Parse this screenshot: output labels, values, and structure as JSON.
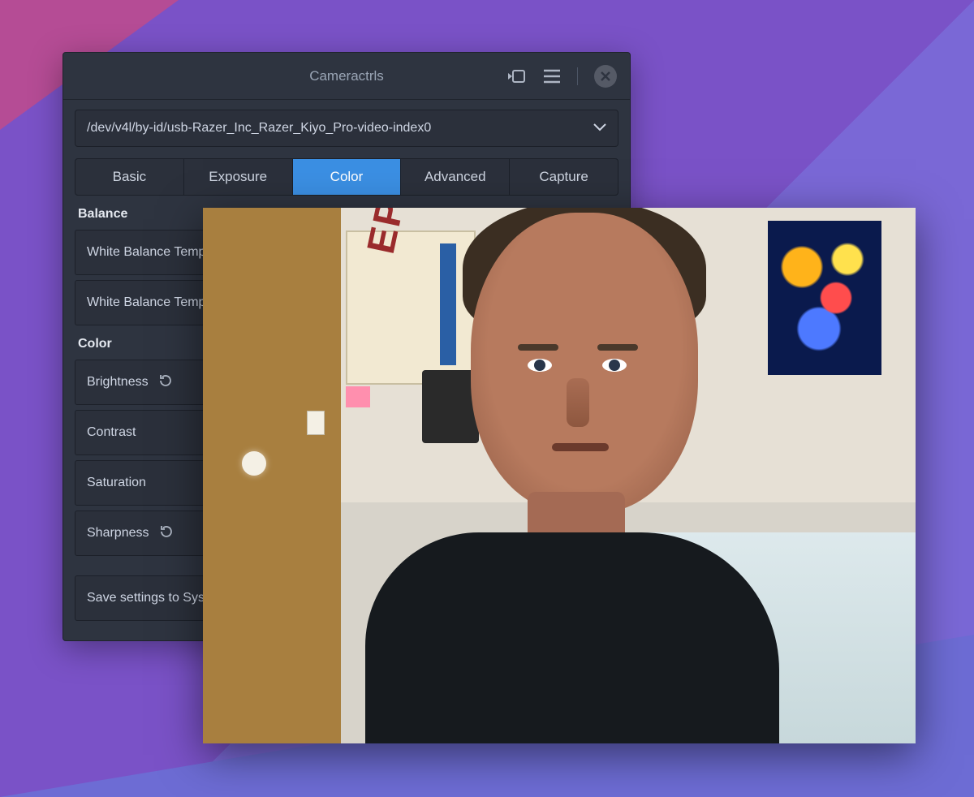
{
  "window": {
    "title": "Cameractrls"
  },
  "device": {
    "path": "/dev/v4l/by-id/usb-Razer_Inc_Razer_Kiyo_Pro-video-index0"
  },
  "tabs": {
    "items": [
      {
        "label": "Basic",
        "active": false
      },
      {
        "label": "Exposure",
        "active": false
      },
      {
        "label": "Color",
        "active": true
      },
      {
        "label": "Advanced",
        "active": false
      },
      {
        "label": "Capture",
        "active": false
      }
    ]
  },
  "sections": {
    "balance": {
      "label": "Balance",
      "rows": [
        {
          "label": "White Balance Tempe"
        },
        {
          "label": "White Balance Tempe"
        }
      ]
    },
    "color": {
      "label": "Color",
      "rows": [
        {
          "label": "Brightness",
          "hasReset": true
        },
        {
          "label": "Contrast",
          "hasReset": false
        },
        {
          "label": "Saturation",
          "hasReset": false
        },
        {
          "label": "Sharpness",
          "hasReset": true
        }
      ]
    }
  },
  "footer": {
    "save_label": "Save settings to Syste"
  },
  "pic1_text": "EPIC"
}
